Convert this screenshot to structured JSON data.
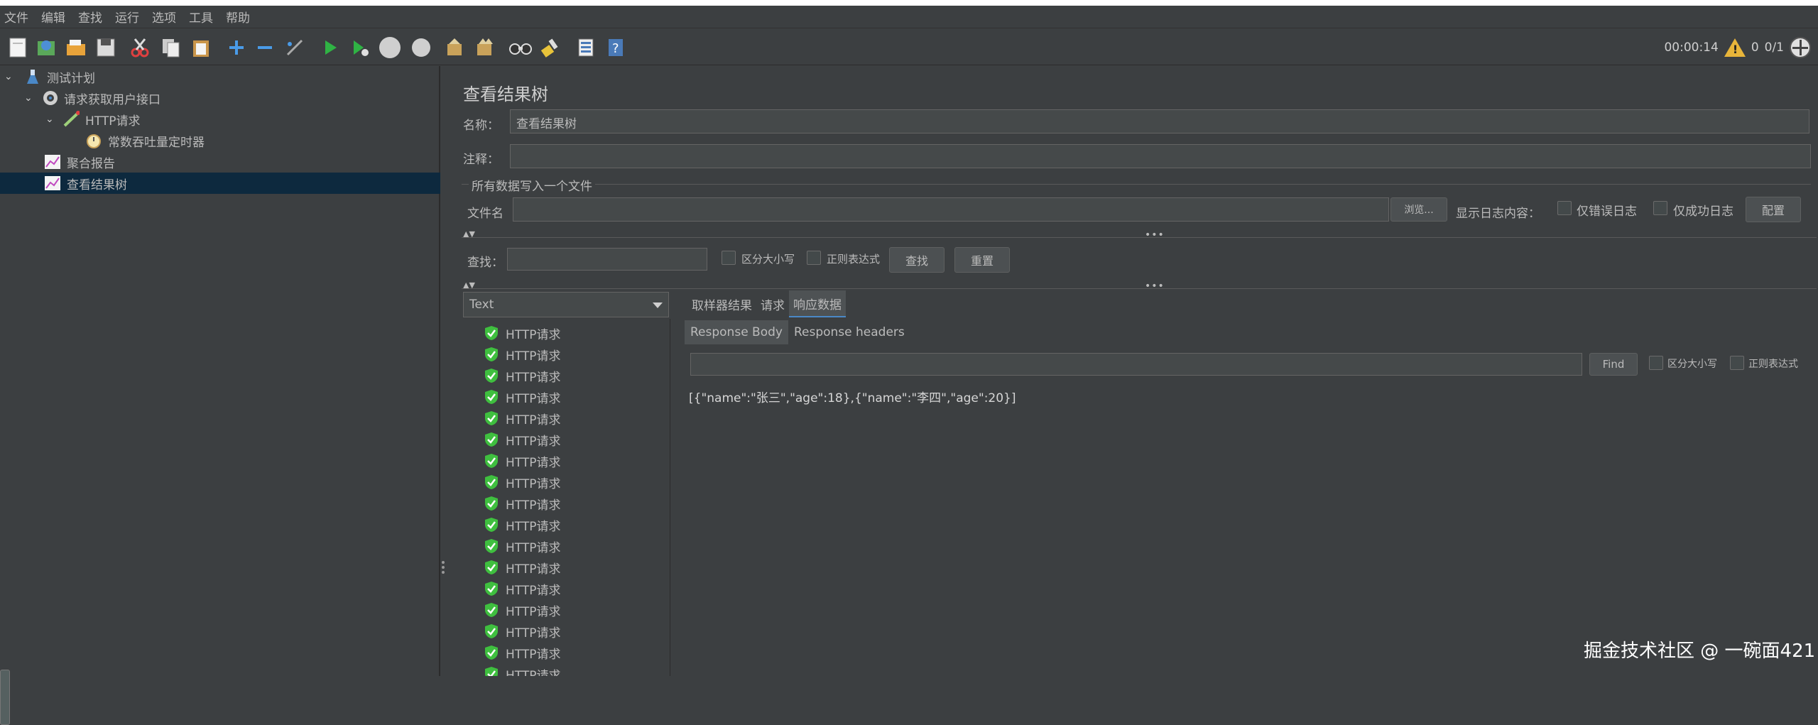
{
  "menu": [
    "文件",
    "编辑",
    "查找",
    "运行",
    "选项",
    "工具",
    "帮助"
  ],
  "toolbar": {
    "elapsed_time": "00:00:14",
    "warning_count": "0",
    "thread_count": "0/1"
  },
  "tree": {
    "test_plan": "测试计划",
    "thread_group": "请求获取用户接口",
    "http_request": "HTTP请求",
    "timer": "常数吞吐量定时器",
    "aggregate_report": "聚合报告",
    "view_results_tree": "查看结果树"
  },
  "panel": {
    "title": "查看结果树",
    "name_label": "名称：",
    "name_value": "查看结果树",
    "comment_label": "注释：",
    "comment_value": "",
    "fieldset_title": "所有数据写入一个文件",
    "filename_label": "文件名",
    "filename_value": "",
    "browse_button": "浏览...",
    "log_display_label": "显示日志内容：",
    "errors_only_label": "仅错误日志",
    "success_only_label": "仅成功日志",
    "configure_button": "配置",
    "search_label": "查找：",
    "search_value": "",
    "case_sensitive_label": "区分大小写",
    "regex_label": "正则表达式",
    "find_button": "查找",
    "reset_button": "重置"
  },
  "results": {
    "renderer_selected": "Text",
    "items": [
      "HTTP请求",
      "HTTP请求",
      "HTTP请求",
      "HTTP请求",
      "HTTP请求",
      "HTTP请求",
      "HTTP请求",
      "HTTP请求",
      "HTTP请求",
      "HTTP请求",
      "HTTP请求",
      "HTTP请求",
      "HTTP请求",
      "HTTP请求",
      "HTTP请求",
      "HTTP请求",
      "HTTP请求"
    ]
  },
  "tabs": [
    "取样器结果",
    "请求",
    "响应数据"
  ],
  "subtabs": [
    "Response Body",
    "Response headers"
  ],
  "response_search": {
    "value": "",
    "find_button": "Find",
    "case_sensitive_label": "区分大小写",
    "regex_label": "正则表达式"
  },
  "response_body": "[{\"name\":\"张三\",\"age\":18},{\"name\":\"李四\",\"age\":20}]",
  "watermark": "掘金技术社区 @ 一碗面421",
  "colors": {
    "background": "#3c3f41",
    "selection": "#0d293e",
    "success_green": "#3fbf3f",
    "warning_yellow": "#e8b53a"
  }
}
